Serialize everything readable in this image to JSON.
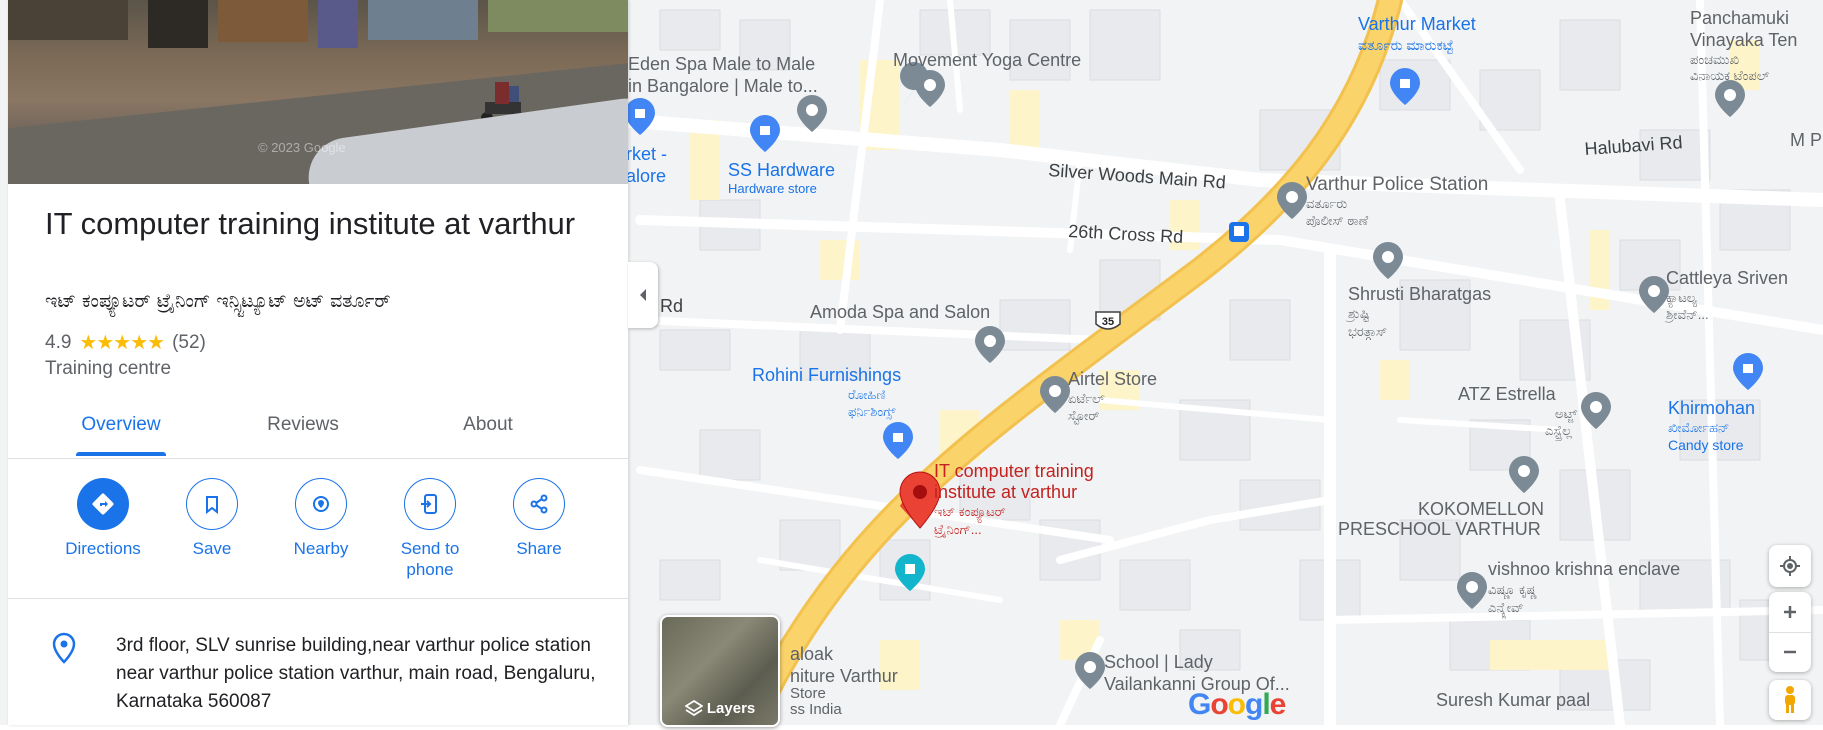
{
  "place": {
    "title": "IT computer training institute at varthur",
    "local_name": "ಇಟ್ ಕಂಪ್ಯೂಟರ್ ಟ್ರೈನಿಂಗ್ ಇನ್ಸ್ಟಿಟ್ಯೂಟ್ ಅಟ್ ವರ್ತೂರ್",
    "rating": "4.9",
    "stars": "★★★★★",
    "review_count": "(52)",
    "rating_value": 4.9,
    "category": "Training centre",
    "address": "3rd floor, SLV sunrise building,near varthur police station near varthur police station varthur, main road, Bengaluru, Karnataka 560087"
  },
  "photo": {
    "watermark": "© 2023 Google"
  },
  "tabs": [
    {
      "label": "Overview",
      "active": true
    },
    {
      "label": "Reviews",
      "active": false
    },
    {
      "label": "About",
      "active": false
    }
  ],
  "actions": [
    {
      "label": "Directions",
      "icon": "directions-icon"
    },
    {
      "label": "Save",
      "icon": "bookmark-icon"
    },
    {
      "label": "Nearby",
      "icon": "nearby-icon"
    },
    {
      "label": "Send to phone",
      "icon": "send-to-phone-icon"
    },
    {
      "label": "Share",
      "icon": "share-icon"
    }
  ],
  "map": {
    "roads": {
      "silver_woods": "Silver Woods Main Rd",
      "cross_26": "26th Cross Rd",
      "halubavi": "Halubavi Rd",
      "rd_partial": "Rd",
      "route_35": "35"
    },
    "places": {
      "varthur_market": "Varthur Market",
      "varthur_market_kn": "ವರ್ತೂರು ಮಾರುಕಟ್ಟೆ",
      "panchamuki_1": "Panchamuki",
      "panchamuki_2": "Vinayaka Ten",
      "panchamuki_kn_1": "ಪಂಚಮುಖಿ",
      "panchamuki_kn_2": "ವಿನಾಯಕ ಟೆಂಪಲ್",
      "m_p": "M P",
      "eden_1": "Eden Spa Male to Male",
      "eden_2": "in Bangalore | Male to...",
      "movement_yoga": "Movement Yoga Centre",
      "market_partial_1": "rket -",
      "market_partial_2": "alore",
      "ss_hardware": "SS Hardware",
      "ss_hardware_sub": "Hardware store",
      "police": "Varthur Police Station",
      "police_kn_1": "ವರ್ತೂರು",
      "police_kn_2": "ಪೊಲೀಸ್ ಠಾಣೆ",
      "shrusti": "Shrusti Bharatgas",
      "shrusti_kn_1": "ಶ್ರುಷ್ಟಿ",
      "shrusti_kn_2": "ಭರತ್ಗಾಸ್",
      "cattleya": "Cattleya Sriven",
      "cattleya_kn_1": "ಕ್ಯಾಟಲ್ಯ",
      "cattleya_kn_2": "ಶ್ರೀವೆನ್...",
      "amoda": "Amoda Spa and Salon",
      "rohini": "Rohini Furnishings",
      "rohini_kn_1": "ರೋಹಿಣಿ",
      "rohini_kn_2": "ಫರ್ನಿಶಿಂಗ್ಸ್",
      "airtel": "Airtel Store",
      "airtel_kn_1": "ಏರ್ಟೆಲ್",
      "airtel_kn_2": "ಸ್ಟೋರ್",
      "atz": "ATZ Estrella",
      "atz_kn_1": "ಅಟ್ಜ್",
      "atz_kn_2": "ಎಸ್ಟ್ರೆಲ್ಲ",
      "khirmohan": "Khirmohan",
      "khirmohan_kn": "ಖೀರ್ಮೋಹನ್",
      "khirmohan_sub": "Candy store",
      "selected_1": "IT computer training",
      "selected_2": "institute at varthur",
      "selected_kn_1": "ಇಟ್ ಕಂಪ್ಯೂಟರ್",
      "selected_kn_2": "ಟ್ರೈನಿಂಗ್...",
      "kokomellon_1": "KOKOMELLON",
      "kokomellon_2": "PRESCHOOL VARTHUR",
      "vishnoo": "vishnoo krishna enclave",
      "vishnoo_kn_1": "ವಿಷ್ಣೂ ಕೃಷ್ಣ",
      "vishnoo_kn_2": "ಎನ್ಕ್ಲೇವ್",
      "aloak_1": "aloak",
      "aloak_2": "niture Varthur",
      "aloak_3": "Store",
      "aloak_4": "ss India",
      "school_1": "School | Lady",
      "school_2": "Vailankanni Group Of...",
      "suresh": "Suresh Kumar paal"
    },
    "layers_label": "Layers",
    "google_logo": "Google"
  },
  "colors": {
    "accent": "#1a73e8",
    "star": "#fbbc04",
    "highway": "#fad36b",
    "pin_red": "#ea4335",
    "poi_gray": "#7b8a95",
    "poi_blue": "#4285f4",
    "poi_teal": "#12b5cb"
  }
}
